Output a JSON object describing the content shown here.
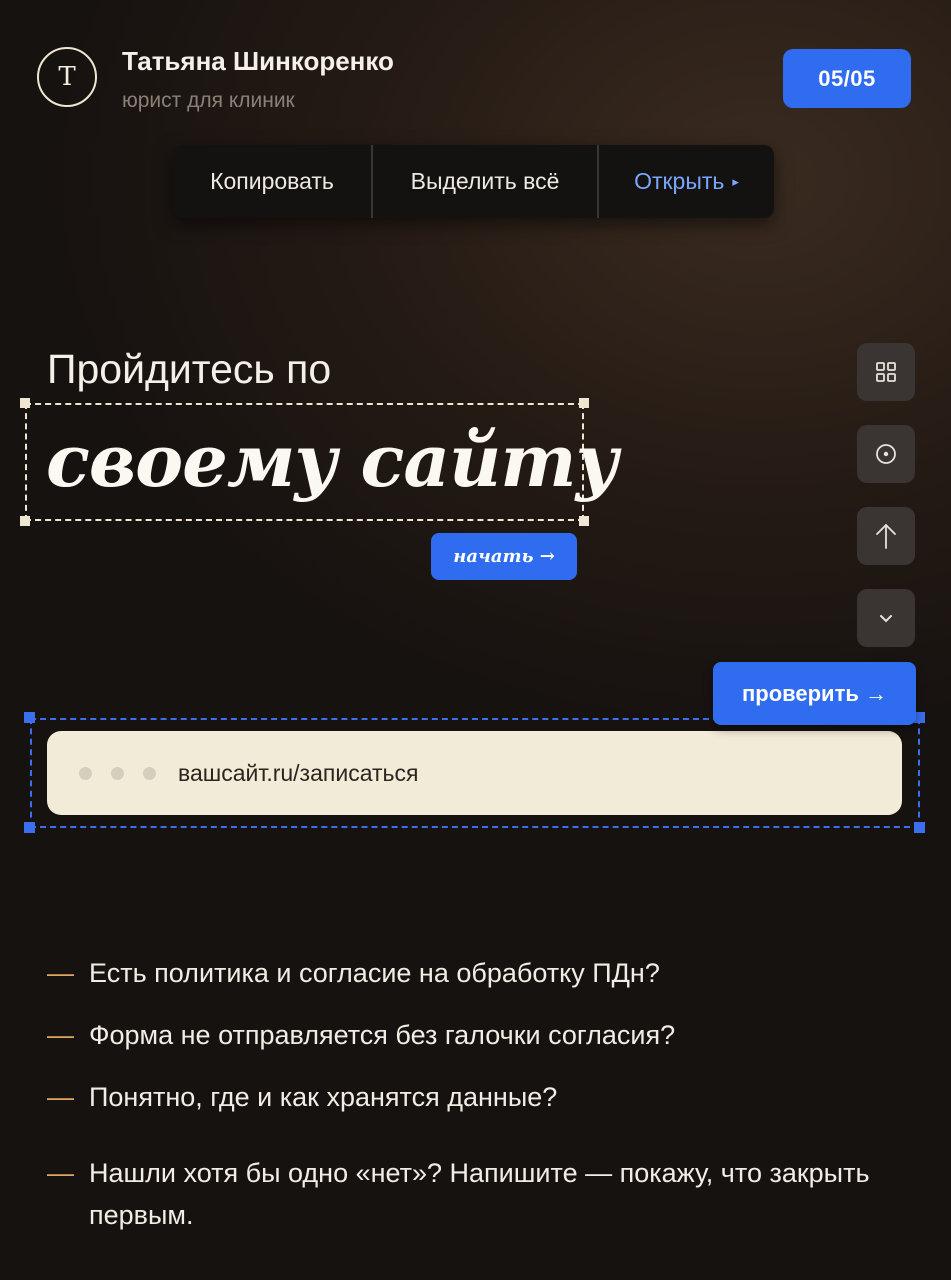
{
  "header": {
    "avatar_letter": "Т",
    "name": "Татьяна Шинкоренко",
    "role": "юрист для клиник",
    "counter": "05/05"
  },
  "context_menu": {
    "copy": "Копировать",
    "select_all": "Выделить всё",
    "open": "Открыть",
    "open_arrow": "▸"
  },
  "heading": {
    "line1": "Пройдитесь по",
    "line2": "своему сайту",
    "start_button": "начать →"
  },
  "tools": {
    "icons": [
      "grid-icon",
      "target-icon",
      "arrow-up-icon",
      "chevron-down-icon"
    ]
  },
  "check_button": "проверить →",
  "url_bar": {
    "url": "вашсайт.ru/записаться"
  },
  "checklist": {
    "dash": "—",
    "items": [
      "Есть политика и согласие на обработку ПДн?",
      "Форма не отправляется без галочки согласия?",
      "Понятно, где и как хранятся данные?",
      "Нашли хотя бы одно «нет»? Напишите — покажу, что закрыть первым."
    ]
  },
  "colors": {
    "accent_blue": "#2f6cf0",
    "dash_orange": "#e0a561",
    "cream": "#f2ebd8"
  }
}
